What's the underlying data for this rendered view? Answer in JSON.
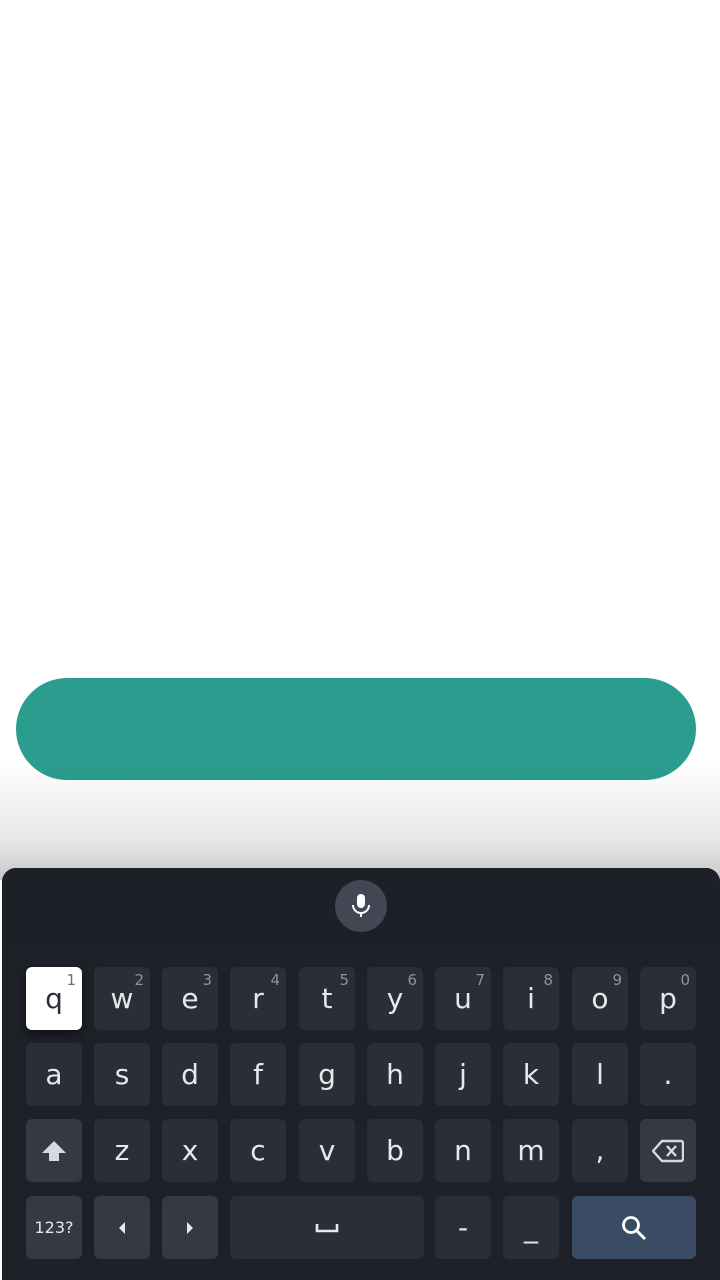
{
  "colors": {
    "primary_button": "#2a9d8f",
    "keyboard_bg": "#1e2128",
    "keyboard_top_bg": "#1d2027",
    "key_bg": "#2a2f37",
    "key_func_bg": "#343943",
    "search_key_bg": "#3a4c63",
    "mic_bg": "#434754",
    "active_key_bg": "#ffffff"
  },
  "keyboard": {
    "voice_button_icon": "mic-icon",
    "rows": [
      [
        {
          "label": "q",
          "hint": "1",
          "active": true
        },
        {
          "label": "w",
          "hint": "2"
        },
        {
          "label": "e",
          "hint": "3"
        },
        {
          "label": "r",
          "hint": "4"
        },
        {
          "label": "t",
          "hint": "5"
        },
        {
          "label": "y",
          "hint": "6"
        },
        {
          "label": "u",
          "hint": "7"
        },
        {
          "label": "i",
          "hint": "8"
        },
        {
          "label": "o",
          "hint": "9"
        },
        {
          "label": "p",
          "hint": "0"
        }
      ],
      [
        {
          "label": "a"
        },
        {
          "label": "s"
        },
        {
          "label": "d"
        },
        {
          "label": "f"
        },
        {
          "label": "g"
        },
        {
          "label": "h"
        },
        {
          "label": "j"
        },
        {
          "label": "k"
        },
        {
          "label": "l"
        },
        {
          "label": "."
        }
      ],
      [
        {
          "icon": "shift-icon"
        },
        {
          "label": "z"
        },
        {
          "label": "x"
        },
        {
          "label": "c"
        },
        {
          "label": "v"
        },
        {
          "label": "b"
        },
        {
          "label": "n"
        },
        {
          "label": "m"
        },
        {
          "label": ","
        },
        {
          "icon": "backspace-icon"
        }
      ],
      [
        {
          "label": "123?"
        },
        {
          "icon": "arrow-left-icon"
        },
        {
          "icon": "arrow-right-icon"
        },
        {
          "icon": "space-icon"
        },
        {
          "label": "-"
        },
        {
          "label": "_"
        },
        {
          "icon": "search-icon"
        }
      ]
    ]
  }
}
